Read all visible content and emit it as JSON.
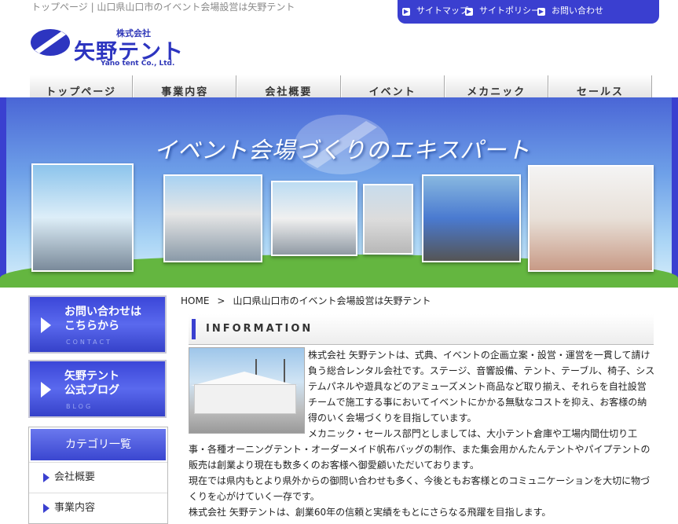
{
  "header": {
    "breadcrumb_title": "トップページ | 山口県山口市のイベント会場設営は矢野テント",
    "util_links": [
      "サイトマップ",
      "サイトポリシー",
      "お問い合わせ"
    ],
    "logo": {
      "kabushiki": "株式会社",
      "name": "矢野テント",
      "english": "Yano tent Co., Ltd."
    }
  },
  "nav": [
    "トップページ",
    "事業内容",
    "会社概要",
    "イベント",
    "メカニック",
    "セールス"
  ],
  "hero": {
    "title": "イベント会場づくりのエキスパート"
  },
  "breadcrumb": {
    "home": "HOME",
    "sep": ">",
    "current": "山口県山口市のイベント会場設営は矢野テント"
  },
  "sidebar": {
    "contact": {
      "line1": "お問い合わせは",
      "line2": "こちらから",
      "sub": "CONTACT"
    },
    "blog": {
      "line1": "矢野テント",
      "line2": "公式ブログ",
      "sub": "BLOG"
    },
    "category_title": "カテゴリ一覧",
    "categories": [
      "会社概要",
      "事業内容"
    ]
  },
  "info": {
    "heading": "INFORMATION",
    "p1": "株式会社 矢野テントは、式典、イベントの企画立案・設営・運営を一貫して請け負う総合レンタル会社です。ステージ、音響設備、テント、テーブル、椅子、システムパネルや遊具などのアミューズメント商品など取り揃え、それらを自社設営チームで施工する事においてイベントにかかる無駄なコストを抑え、お客様の納得のいく会場づくりを目指しています。",
    "p2": "メカニック・セールス部門としましては、大小テント倉庫や工場内間仕切り工事・各種オーニングテント・オーダーメイド帆布バッグの制作、また集会用かんたんテントやパイプテントの販売は創業より現在も数多くのお客様へ御愛顧いただいております。",
    "p3": "現在では県内もとより県外からの御問い合わせも多く、今後ともお客様とのコミュニケーションを大切に物づくりを心がけていく一存です。",
    "p4": "株式会社 矢野テントは、創業60年の信頼と実績をもとにさらなる飛躍を目指します。"
  },
  "colors": {
    "brand_blue": "#3a40d0",
    "nav_triangle": "#3a40d0"
  }
}
